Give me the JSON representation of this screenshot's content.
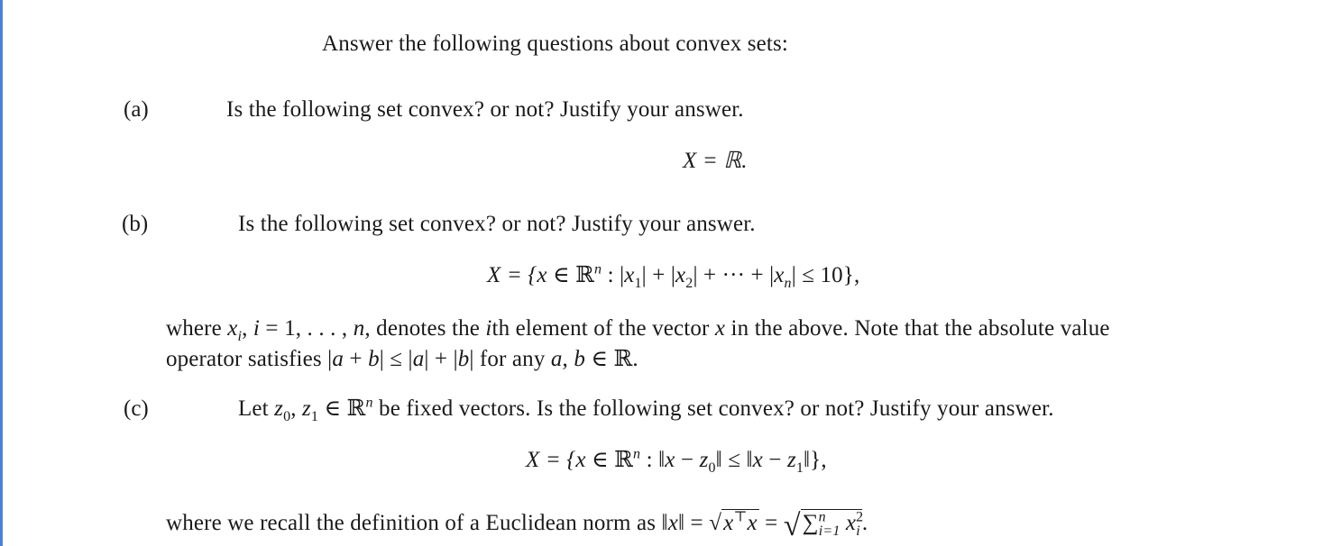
{
  "intro": "Answer the following questions about convex sets:",
  "accent_color": "#4a7fe0",
  "questions": [
    {
      "label": "(a)",
      "prompt": "Is the following set convex? or not? Justify your answer.",
      "equation": "X = ℝ."
    },
    {
      "label": "(b)",
      "prompt": "Is the following set convex? or not? Justify your answer.",
      "equation_parts": {
        "lhs": "X = {",
        "x": "x",
        "in": " ∈ ",
        "R": "ℝ",
        "n": "n",
        "colon": " : |",
        "x1": "x",
        "s1": "1",
        "mid1": "| + |",
        "x2": "x",
        "s2": "2",
        "mid2": "| + ··· + |",
        "xn": "x",
        "sn": "n",
        "tail": "| ≤ 10},"
      },
      "note_line1_parts": {
        "w1": "where ",
        "xi": "x",
        "si": "i",
        "c1": ", ",
        "i": "i",
        "eq": " = 1, . . . , ",
        "n": "n",
        "rest": ", denotes the ",
        "ith_i": "i",
        "ith_rest": "th element of the vector ",
        "x": "x",
        "end": " in the above. Note that the absolute value"
      },
      "note_line2_parts": {
        "start": "operator satisfies |",
        "a1": "a",
        "p1": " + ",
        "b1": "b",
        "m1": "| ≤ |",
        "a2": "a",
        "m2": "| + |",
        "b2": "b",
        "m3": "| for any ",
        "a3": "a",
        "comma": ", ",
        "b3": "b",
        "in": " ∈ ",
        "R": "ℝ",
        "dot": "."
      }
    },
    {
      "label": "(c)",
      "prompt_parts": {
        "let": "Let ",
        "z": "z",
        "s0": "0",
        "comma": ", ",
        "z1": "z",
        "s1": "1",
        "in": " ∈ ",
        "R": "ℝ",
        "n": "n",
        "rest": " be fixed vectors. Is the following set convex? or not? Justify your answer."
      },
      "equation_parts": {
        "lhs": "X = {",
        "x": "x",
        "in": " ∈ ",
        "R": "ℝ",
        "n": "n",
        "c": " : ‖",
        "x2": "x",
        "minus1": " − ",
        "z0": "z",
        "s0": "0",
        "mid": "‖ ≤ ‖",
        "x3": "x",
        "minus2": " − ",
        "z1": "z",
        "s1": "1",
        "tail": "‖},"
      },
      "note_parts": {
        "start": "where we recall the definition of a Euclidean norm as ‖",
        "x": "x",
        "eq1": "‖ = ",
        "root": "√",
        "xT": "x",
        "T": "⊤",
        "x2": "x",
        "eq2": " = ",
        "root2": "√",
        "sum": "∑",
        "sup_n": "n",
        "sub_i": "i=1",
        "xi": "x",
        "sq": "2",
        "si": "i",
        "dot": "."
      }
    }
  ]
}
